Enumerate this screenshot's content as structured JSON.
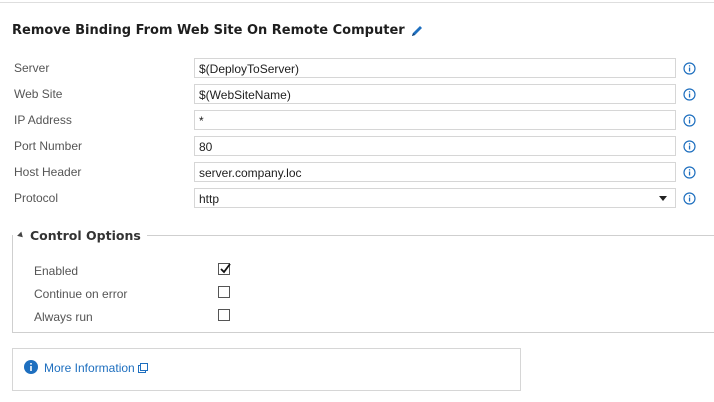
{
  "title": "Remove Binding From Web Site On Remote Computer",
  "fields": [
    {
      "label": "Server",
      "value": "$(DeployToServer)"
    },
    {
      "label": "Web Site",
      "value": "$(WebSiteName)"
    },
    {
      "label": "IP Address",
      "value": "*"
    },
    {
      "label": "Port Number",
      "value": "80"
    },
    {
      "label": "Host Header",
      "value": "server.company.loc"
    },
    {
      "label": "Protocol",
      "value": "http"
    }
  ],
  "control_options": {
    "title": "Control Options",
    "options": [
      {
        "label": "Enabled",
        "checked": true
      },
      {
        "label": "Continue on error",
        "checked": false
      },
      {
        "label": "Always run",
        "checked": false
      }
    ]
  },
  "more_info": {
    "label": "More Information"
  },
  "colors": {
    "accent": "#1e6fbf",
    "info_icon": "#1e6fbf",
    "border": "#d6d6d6"
  }
}
